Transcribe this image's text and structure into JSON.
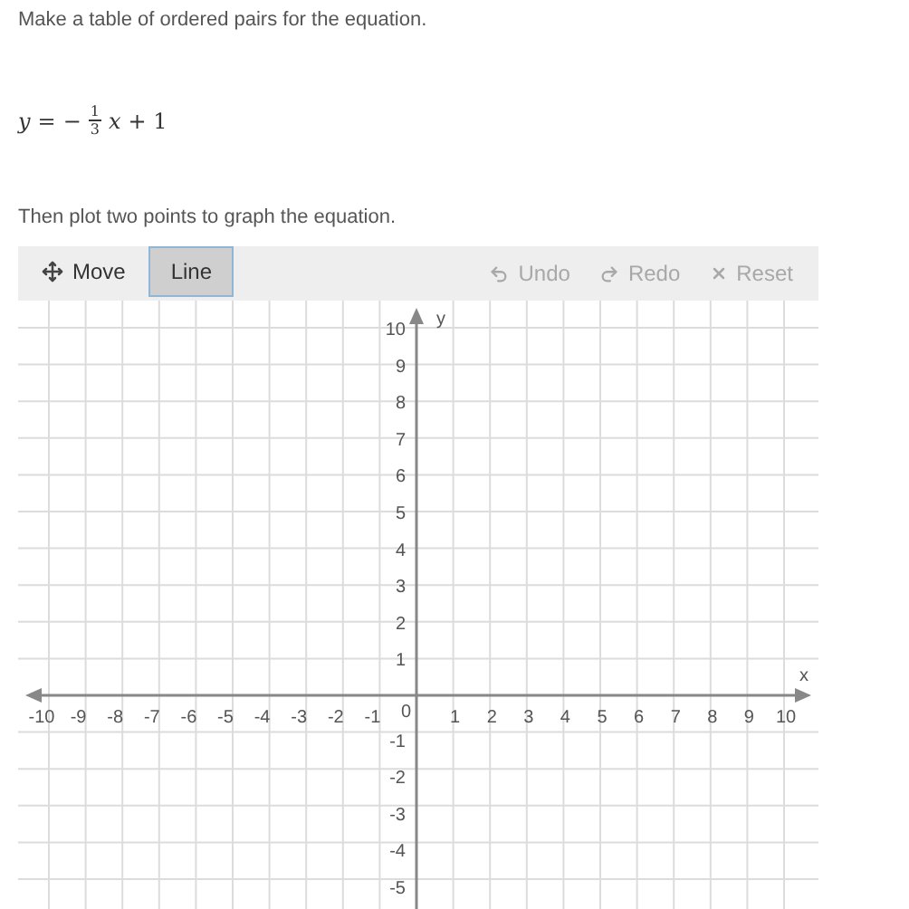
{
  "instructions": [
    "Make a table of ordered pairs for the equation.",
    "Then plot two points to graph the equation."
  ],
  "equation": {
    "lhs": "y",
    "equals": "=",
    "sign": "−",
    "numerator": "1",
    "denominator": "3",
    "variable": "x",
    "tail": "+ 1"
  },
  "toolbar": {
    "tools": [
      {
        "label": "Move",
        "kind": "move",
        "selected": false
      },
      {
        "label": "Line",
        "kind": "line",
        "selected": true
      }
    ],
    "actions": [
      {
        "label": "Undo",
        "kind": "undo",
        "disabled": true
      },
      {
        "label": "Redo",
        "kind": "redo",
        "disabled": true
      },
      {
        "label": "Reset",
        "kind": "reset",
        "disabled": true
      }
    ]
  },
  "graph": {
    "x_axis_label": "x",
    "y_axis_label": "y",
    "origin_label": "0",
    "x_tick_labels": [
      "-10",
      "-9",
      "-8",
      "-7",
      "-6",
      "-5",
      "-4",
      "-3",
      "-2",
      "-1",
      "1",
      "2",
      "3",
      "4",
      "5",
      "6",
      "7",
      "8",
      "9",
      "10"
    ],
    "y_tick_labels": [
      "10",
      "9",
      "8",
      "7",
      "6",
      "5",
      "4",
      "3",
      "2",
      "1",
      "-1",
      "-2",
      "-3",
      "-4",
      "-5"
    ]
  }
}
